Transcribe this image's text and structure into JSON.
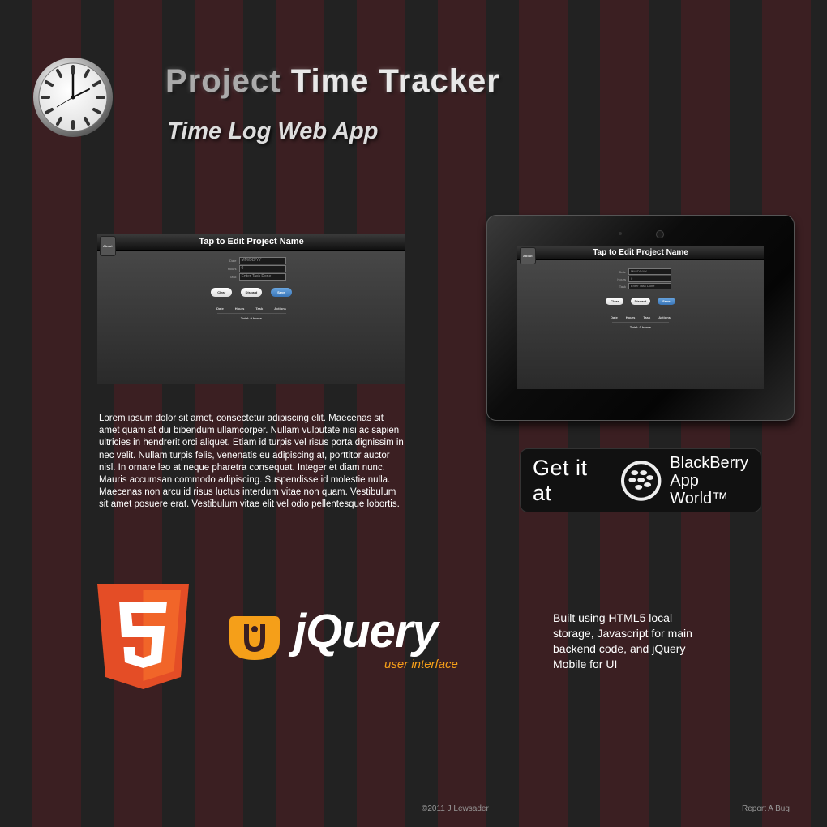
{
  "header": {
    "title_part1": "Project",
    "title_part2": "Time Tracker",
    "subtitle": "Time Log Web App"
  },
  "app_preview": {
    "back_label": "About",
    "header_title": "Tap to Edit Project Name",
    "fields": [
      {
        "label": "Date",
        "value": "MM/DD/YY"
      },
      {
        "label": "Hours",
        "value": "0"
      },
      {
        "label": "Task",
        "value": "Enter Task Done"
      }
    ],
    "buttons": {
      "clear": "Clear",
      "discard": "Discard",
      "save": "Save"
    },
    "columns": [
      "Date",
      "Hours",
      "Task",
      "Actions"
    ],
    "total": "Total: 0 hours"
  },
  "description": "Lorem ipsum dolor sit amet, consectetur adipiscing elit. Maecenas sit amet quam at dui bibendum ullamcorper. Nullam vulputate nisi ac sapien ultricies in hendrerit orci aliquet. Etiam id turpis vel risus porta dignissim in nec velit. Nullam turpis felis, venenatis eu adipiscing at, porttitor auctor nisl. In ornare leo at neque pharetra consequat. Integer et diam nunc. Mauris accumsan commodo adipiscing. Suspendisse id molestie nulla. Maecenas non arcu id risus luctus interdum vitae non quam. Vestibulum sit amet posuere erat. Vestibulum vitae elit vel odio pellentesque lobortis.",
  "badge": {
    "get_it": "Get it at",
    "brand_line1": "BlackBerry",
    "brand_line2": "App World™"
  },
  "logos": {
    "html5_digit": "5",
    "jquery_word": "jQuery",
    "jquery_sub": "user interface"
  },
  "built_with": "Built using HTML5 local storage, Javascript for main backend code, and jQuery Mobile for UI",
  "footer": {
    "copyright": "©2011  J Lewsader",
    "report_bug": "Report A Bug"
  },
  "colors": {
    "stripe_dark": "#222222",
    "stripe_maroon": "#3b1f22",
    "html5_orange": "#e44d26",
    "jquery_orange": "#f59f19",
    "save_blue": "#3a76b8"
  }
}
